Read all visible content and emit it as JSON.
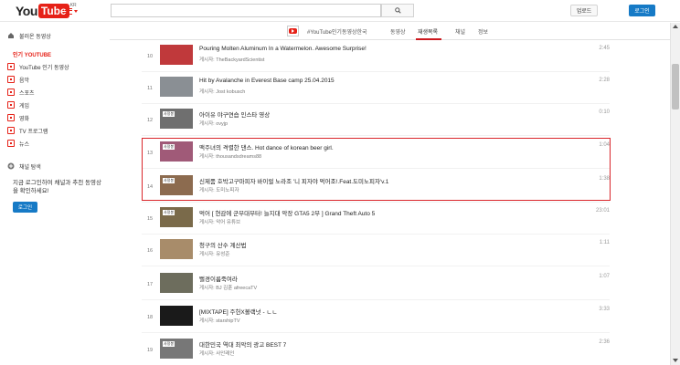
{
  "header": {
    "logo_you": "You",
    "logo_tube": "Tube",
    "logo_region": "KR",
    "search_placeholder": "",
    "upload_label": "업로드",
    "login_label": "로그인"
  },
  "sidebar": {
    "popular": "불러온 동영상",
    "section_title": "인기 YOUTUBE",
    "items": [
      {
        "label": "YouTube 인기 동영상",
        "icon": "youtube-icon"
      },
      {
        "label": "음악",
        "icon": "music-icon"
      },
      {
        "label": "스포츠",
        "icon": "sports-icon"
      },
      {
        "label": "게임",
        "icon": "gaming-icon"
      },
      {
        "label": "영화",
        "icon": "movies-icon"
      },
      {
        "label": "TV 프로그램",
        "icon": "tv-icon"
      },
      {
        "label": "뉴스",
        "icon": "news-icon"
      }
    ],
    "browse_channels": "채널 탐색",
    "signin_prompt": "지금 로그인하여 채널과 추천 동영상을 확인하세요!",
    "signin_button": "로그인"
  },
  "tabs": {
    "channel_name": "#YouTube인기동영상한국",
    "items": [
      "동영상",
      "재생목록",
      "채널",
      "정보"
    ],
    "active": "재생목록"
  },
  "playlist": [
    {
      "index": "10",
      "title": "Pouring Molten Aluminum In a Watermelon. Awesome Surprise!",
      "author": "게시자: TheBackyardScientist",
      "duration": "2:45",
      "thumb_color": "#c0393b"
    },
    {
      "index": "11",
      "title": "Hit by Avalanche in Everest Base camp 25.04.2015",
      "author": "게시자: Jost kobusch",
      "duration": "2:28",
      "thumb_color": "#8a8f94"
    },
    {
      "index": "12",
      "title": "아이유 야구연습 인스타 영상",
      "author": "게시자: ovyjp",
      "duration": "0:10",
      "thumb_color": "#6f6f6f",
      "thumb_tag": "사정봉"
    },
    {
      "index": "13",
      "title": "맥주녀의 격렬한 댄스. Hot dance of korean beer girl.",
      "author": "게시자: thousandsdreams88",
      "duration": "1:04",
      "thumb_color": "#a05a78",
      "thumb_tag": "사정봉"
    },
    {
      "index": "14",
      "title": "신제품 호박고구마피자 바이럴 노라조 '니 피자야 먹어조!.Feat.도미노피자'v.1",
      "author": "게시자: 도미노피자",
      "duration": "1:38",
      "thumb_color": "#8c6b4f",
      "thumb_tag": "사정봉"
    },
    {
      "index": "15",
      "title": "먹어 [ 현감에 군부대부터! 늘지대 악장 GTA5 2부 ] Grand Theft Auto 5",
      "author": "게시자: 악어 유튜브",
      "duration": "23:01",
      "thumb_color": "#7a6a4a",
      "thumb_tag": "사정봉"
    },
    {
      "index": "16",
      "title": "청구의 산수 계산법",
      "author": "게시자: 유성준",
      "duration": "1:11",
      "thumb_color": "#a88c6a"
    },
    {
      "index": "17",
      "title": "뻘경이름죽여라",
      "author": "게시자: BJ 김훈 afreecaTV",
      "duration": "1:07",
      "thumb_color": "#6d6d5d"
    },
    {
      "index": "18",
      "title": "[MIXTAPE] 주헌X볼랙넛 - ㄴㄴ",
      "author": "게시자: starshipTV",
      "duration": "3:33",
      "thumb_color": "#1a1a1a"
    },
    {
      "index": "19",
      "title": "대한민국 역대 최악의 광고 BEST 7",
      "author": "게시자: 사안레인",
      "duration": "2:36",
      "thumb_color": "#777777",
      "thumb_tag": "사정봉"
    }
  ]
}
